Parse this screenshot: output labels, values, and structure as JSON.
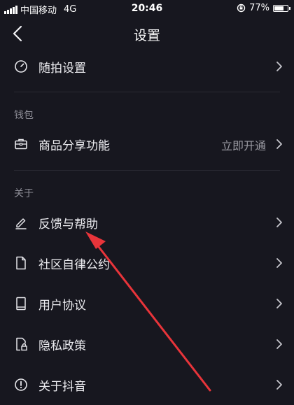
{
  "status_bar": {
    "carrier": "中国移动",
    "network": "4G",
    "time": "20:46",
    "battery": "77%",
    "battery_level": 0.77
  },
  "header": {
    "title": "设置"
  },
  "rows": {
    "snapshot": {
      "label": "随拍设置"
    },
    "share": {
      "label": "商品分享功能",
      "trailing": "立即开通"
    },
    "feedback": {
      "label": "反馈与帮助"
    },
    "community": {
      "label": "社区自律公约"
    },
    "agreement": {
      "label": "用户协议"
    },
    "privacy": {
      "label": "隐私政策"
    },
    "about_douyin": {
      "label": "关于抖音"
    }
  },
  "sections": {
    "wallet": "钱包",
    "about": "关于"
  },
  "colors": {
    "background": "#17171f",
    "annotation_arrow": "#e8343a"
  }
}
